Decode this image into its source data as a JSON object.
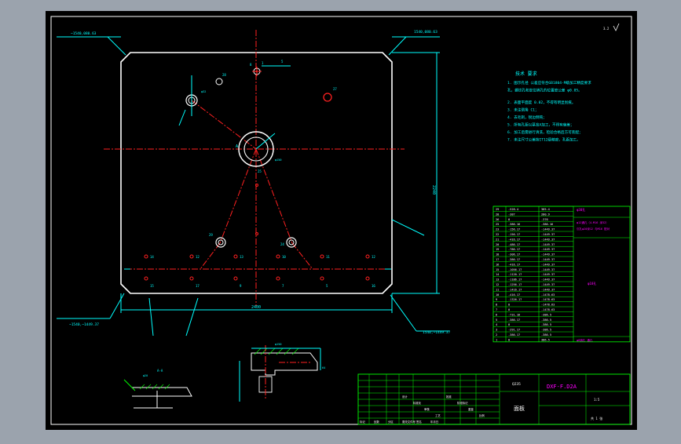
{
  "colors": {
    "backdrop": "#9ba3ad",
    "sheet": "#000000",
    "outline": "#ffffff",
    "dimension": "#00ffff",
    "center_line": "#ff2020",
    "hatch": "#00ff00",
    "annotation": "#ff00ff",
    "frame_green": "#00ff00"
  },
  "dimensions": {
    "top_left": "~1540,080.63",
    "top_right": "1540,080.63",
    "bottom_left": "~1540,~1449.37",
    "bottom_right": "1540,~1449.37",
    "width": "2400",
    "height": "2240"
  },
  "roughness_mark": "3.2",
  "hole_labels": {
    "top_small": "8",
    "top_a": "1",
    "top_b": "5",
    "hole_left": "28",
    "hole_right": "27",
    "center": "A",
    "center_sub": "25",
    "lower_left": "29",
    "lower_right": "24",
    "row_top": [
      "14",
      "12",
      "13",
      "10",
      "11",
      "12"
    ],
    "row_bottom": [
      "15",
      "17",
      "9",
      "7",
      "5",
      "16"
    ]
  },
  "tech_notes": {
    "title": "技术 要求",
    "lines": [
      "1. 图示孔径 公差应符合GB1804-M级加工精度要求",
      "   孔，螺纹孔和定位销孔的位置度公差 φ0.05。",
      "2. 表面平面度 0.02，不得有明显划痕。",
      "3. 未注倒角 C1；",
      "4. 去毛刺，锐边倒钝；",
      "5. 所有孔距以基准A加工，不得有偏差；",
      "6. 加工后需进行清洗，检验合格后方可装配；",
      "7. 未注尺寸公差按IT12级精度，孔距加工。"
    ]
  },
  "coord_table": {
    "rows": [
      [
        "29",
        "-528.4",
        "385.4"
      ],
      [
        "28",
        "-387",
        "280.9"
      ],
      [
        "26",
        "0",
        "-376"
      ],
      [
        "25",
        "-386.16",
        "-386.16"
      ],
      [
        "23",
        "-156.17",
        "-1449.37"
      ],
      [
        "22",
        "-156.17",
        "-1449.37"
      ],
      [
        "21",
        "-416.17",
        "-1449.37"
      ],
      [
        "20",
        "-486.17",
        "-1449.37"
      ],
      [
        "19",
        "-786.17",
        "-1449.37"
      ],
      [
        "18",
        "-306.17",
        "-1449.37"
      ],
      [
        "17",
        "-386.17",
        "-1449.37"
      ],
      [
        "16",
        "-416.17",
        "-1449.37"
      ],
      [
        "15",
        "-1056.17",
        "-1449.37"
      ],
      [
        "14",
        "-1120.17",
        "-1449.37"
      ],
      [
        "13",
        "-1186.17",
        "-1449.37"
      ],
      [
        "12",
        "-1256.17",
        "-1449.37"
      ],
      [
        "11",
        "-1416.17",
        "-1449.37"
      ],
      [
        "10",
        "-416.17",
        "-1478.63"
      ],
      [
        "9",
        "-1326.17",
        "-1478.63"
      ],
      [
        "8",
        "0",
        "-1478.63"
      ],
      [
        "7",
        "0",
        "-1478.63"
      ],
      [
        "6",
        "-731.16",
        "-386.5"
      ],
      [
        "5",
        "-386.17",
        "-386.5"
      ],
      [
        "4",
        "0",
        "-386.5"
      ],
      [
        "3",
        "-291.17",
        "-386.5"
      ],
      [
        "2",
        "-386.17",
        "-386.5"
      ],
      [
        "1",
        "0",
        "386.5"
      ]
    ],
    "side_header": "φ30孔",
    "side_note_a": "φ12通孔（4-M16 深32）",
    "side_note_b": "沉孔φ20深12 与M16 配对",
    "side_note_c": "φ18孔",
    "side_note_d": "φ8销孔 通孔"
  },
  "title_block": {
    "part_name": "面板",
    "drawing_no": "DXF-F.D2A",
    "material": "Q235",
    "scale": "1:5",
    "sheet": "共 1 张",
    "labels": [
      "标记",
      "处数",
      "分区",
      "更改文件号",
      "签名",
      "年月日",
      "设计",
      "标准化",
      "审核",
      "工艺",
      "批准",
      "阶段标记",
      "重量",
      "比例"
    ]
  },
  "section_view": {
    "label": "A-A"
  }
}
